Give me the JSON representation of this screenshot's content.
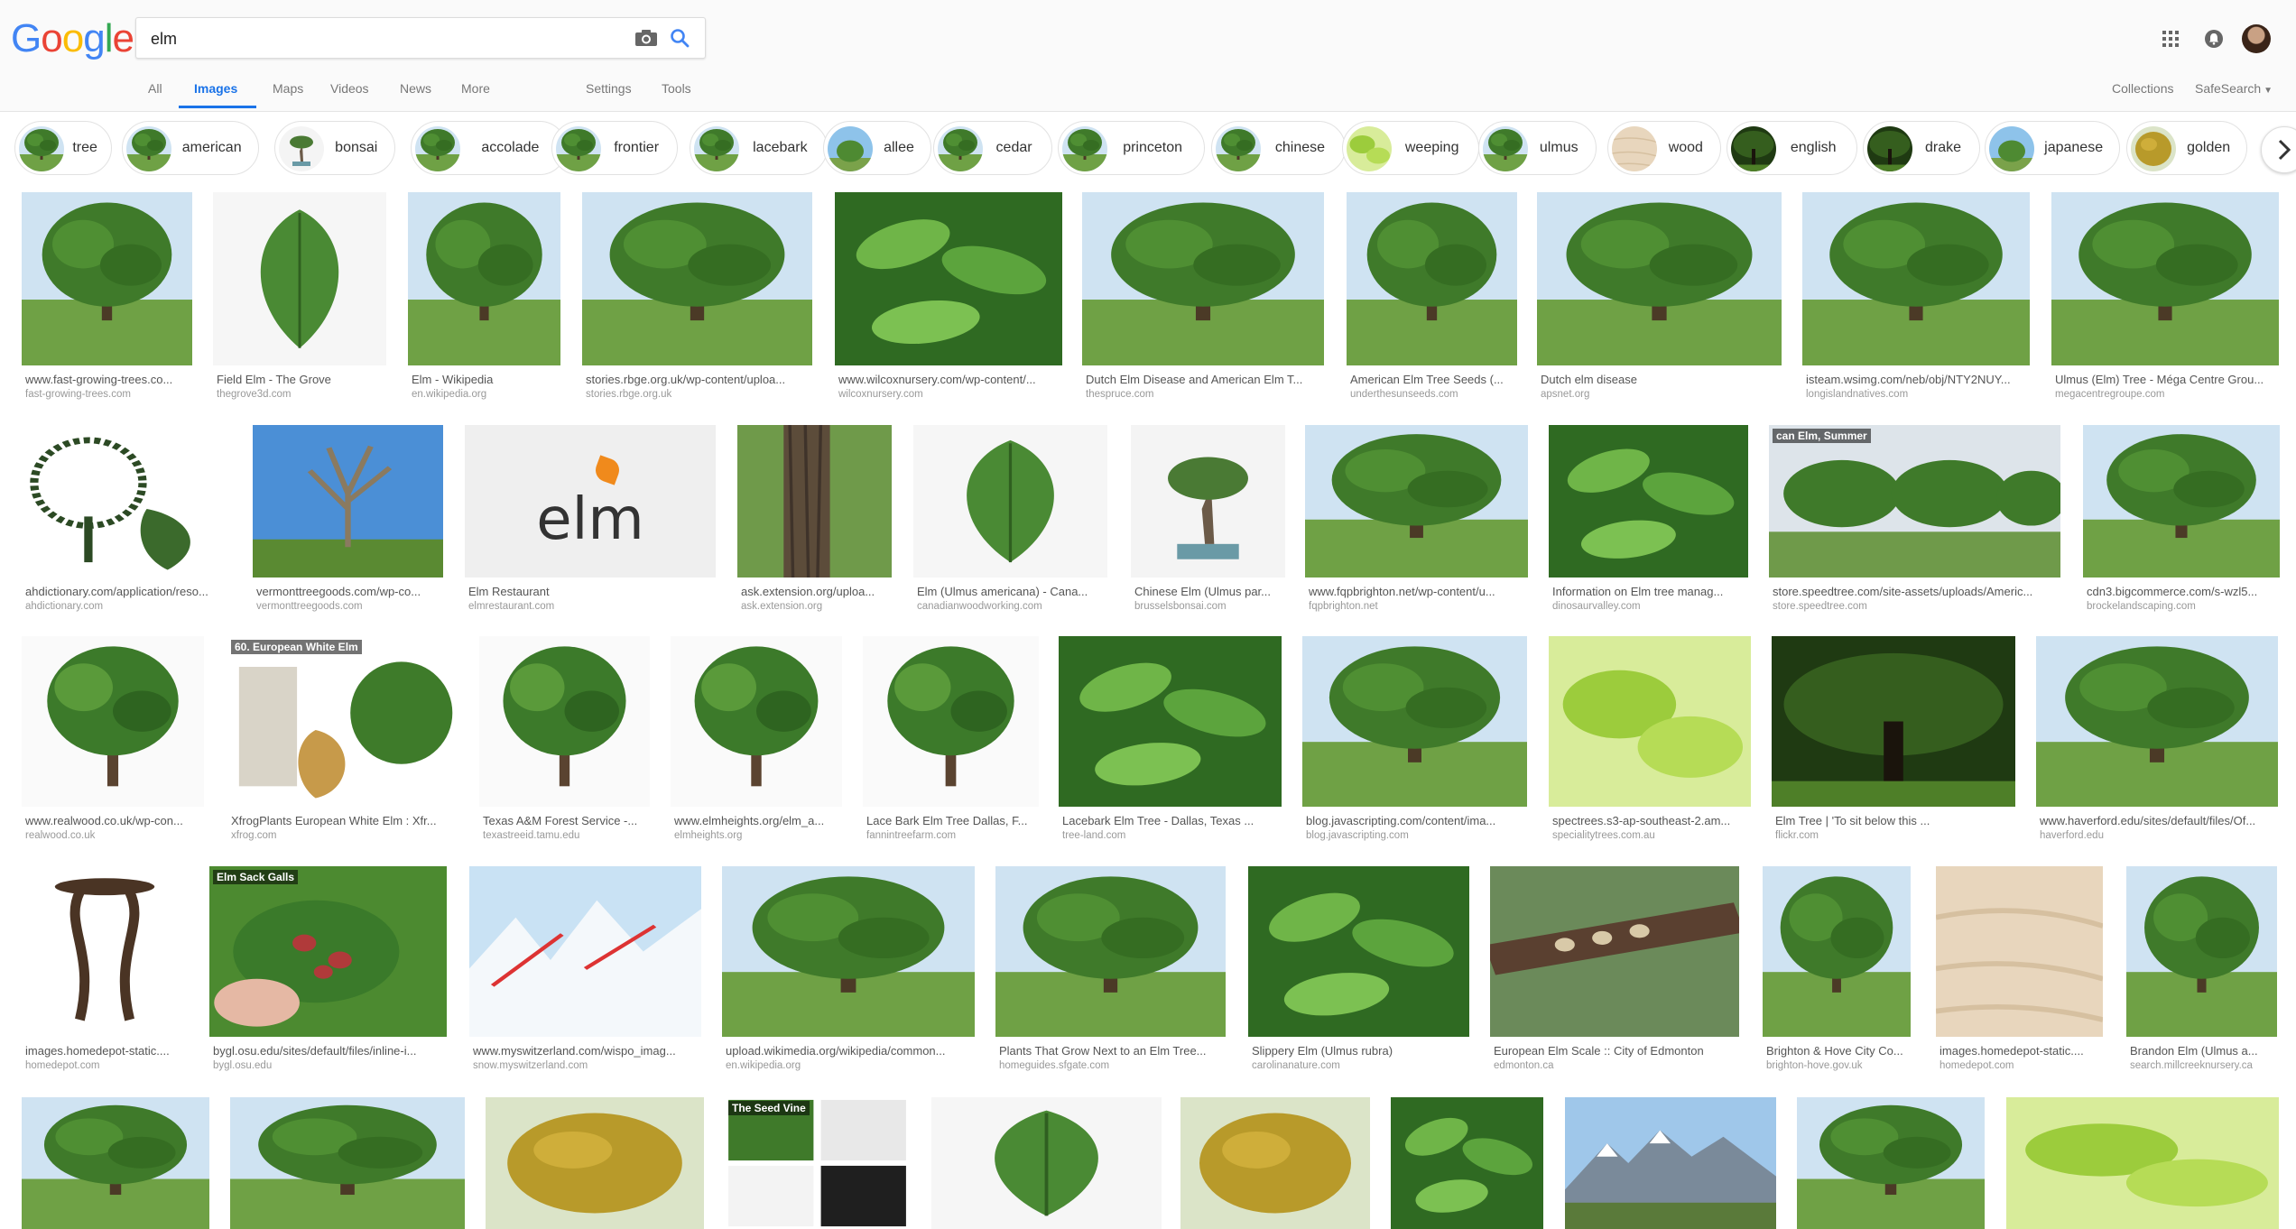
{
  "header": {
    "logo_letters": [
      {
        "ch": "G",
        "color": "#4285F4"
      },
      {
        "ch": "o",
        "color": "#EA4335"
      },
      {
        "ch": "o",
        "color": "#FBBC05"
      },
      {
        "ch": "g",
        "color": "#4285F4"
      },
      {
        "ch": "l",
        "color": "#34A853"
      },
      {
        "ch": "e",
        "color": "#EA4335"
      }
    ],
    "search_value": "elm"
  },
  "nav": {
    "tabs": [
      "All",
      "Images",
      "Maps",
      "Videos",
      "News",
      "More"
    ],
    "active_tab": "Images",
    "settings": "Settings",
    "tools": "Tools",
    "collections": "Collections",
    "safesearch": "SafeSearch"
  },
  "chips": [
    {
      "label": "tree",
      "kind": "tree"
    },
    {
      "label": "american",
      "kind": "tree"
    },
    {
      "label": "bonsai",
      "kind": "bonsai"
    },
    {
      "label": "accolade",
      "kind": "tree"
    },
    {
      "label": "frontier",
      "kind": "tree"
    },
    {
      "label": "lacebark",
      "kind": "tree"
    },
    {
      "label": "allee",
      "kind": "sky"
    },
    {
      "label": "cedar",
      "kind": "tree"
    },
    {
      "label": "princeton",
      "kind": "tree"
    },
    {
      "label": "chinese",
      "kind": "tree"
    },
    {
      "label": "weeping",
      "kind": "lightleaf"
    },
    {
      "label": "ulmus",
      "kind": "tree"
    },
    {
      "label": "wood",
      "kind": "wood"
    },
    {
      "label": "english",
      "kind": "dark"
    },
    {
      "label": "drake",
      "kind": "dark"
    },
    {
      "label": "japanese",
      "kind": "sky"
    },
    {
      "label": "golden",
      "kind": "golden"
    }
  ],
  "results": [
    {
      "title": "www.fast-growing-trees.co...",
      "site": "fast-growing-trees.com",
      "kind": "tree"
    },
    {
      "title": "Field Elm - The Grove",
      "site": "thegrove3d.com",
      "kind": "leafwhite"
    },
    {
      "title": "Elm - Wikipedia",
      "site": "en.wikipedia.org",
      "kind": "tree"
    },
    {
      "title": "stories.rbge.org.uk/wp-content/uploa...",
      "site": "stories.rbge.org.uk",
      "kind": "tree"
    },
    {
      "title": "www.wilcoxnursery.com/wp-content/...",
      "site": "wilcoxnursery.com",
      "kind": "leaves"
    },
    {
      "title": "Dutch Elm Disease and American Elm T...",
      "site": "thespruce.com",
      "kind": "tree"
    },
    {
      "title": "American Elm Tree Seeds (...",
      "site": "underthesunseeds.com",
      "kind": "tree"
    },
    {
      "title": "Dutch elm disease",
      "site": "apsnet.org",
      "kind": "tree"
    },
    {
      "title": "isteam.wsimg.com/neb/obj/NTY2NUY...",
      "site": "longislandnatives.com",
      "kind": "tree"
    },
    {
      "title": "Ulmus (Elm) Tree - Méga Centre Grou...",
      "site": "megacentregroupe.com",
      "kind": "tree"
    },
    {
      "title": "ahdictionary.com/application/reso...",
      "site": "ahdictionary.com",
      "kind": "drawing"
    },
    {
      "title": "vermonttreegoods.com/wp-co...",
      "site": "vermonttreegoods.com",
      "kind": "bare"
    },
    {
      "title": "Elm Restaurant",
      "site": "elmrestaurant.com",
      "kind": "logo",
      "logo_text": "elm"
    },
    {
      "title": "ask.extension.org/uploa...",
      "site": "ask.extension.org",
      "kind": "trunk"
    },
    {
      "title": "Elm (Ulmus americana) - Cana...",
      "site": "canadianwoodworking.com",
      "kind": "leafwhite"
    },
    {
      "title": "Chinese Elm (Ulmus par...",
      "site": "brusselsbonsai.com",
      "kind": "bonsai"
    },
    {
      "title": "www.fqpbrighton.net/wp-content/u...",
      "site": "fqpbrighton.net",
      "kind": "tree"
    },
    {
      "title": "Information on Elm tree manag...",
      "site": "dinosaurvalley.com",
      "kind": "leaves"
    },
    {
      "title": "store.speedtree.com/site-assets/uploads/Americ...",
      "site": "store.speedtree.com",
      "kind": "speedtree",
      "overlay_text": "can Elm, Summer"
    },
    {
      "title": "cdn3.bigcommerce.com/s-wzl5...",
      "site": "brockelandscaping.com",
      "kind": "tree"
    },
    {
      "title": "www.realwood.co.uk/wp-con...",
      "site": "realwood.co.uk",
      "kind": "treewhite"
    },
    {
      "title": "XfrogPlants European White Elm : Xfr...",
      "site": "xfrog.com",
      "kind": "xfrog",
      "overlay_text": "60. European White Elm"
    },
    {
      "title": "Texas A&M Forest Service -...",
      "site": "texastreeid.tamu.edu",
      "kind": "treewhite"
    },
    {
      "title": "www.elmheights.org/elm_a...",
      "site": "elmheights.org",
      "kind": "treewhite"
    },
    {
      "title": "Lace Bark Elm Tree Dallas, F...",
      "site": "fannintreefarm.com",
      "kind": "treewhite"
    },
    {
      "title": "Lacebark Elm Tree - Dallas, Texas ...",
      "site": "tree-land.com",
      "kind": "leaves"
    },
    {
      "title": "blog.javascripting.com/content/ima...",
      "site": "blog.javascripting.com",
      "kind": "tree"
    },
    {
      "title": "spectrees.s3-ap-southeast-2.am...",
      "site": "specialitytrees.com.au",
      "kind": "lightleaf"
    },
    {
      "title": "Elm Tree | 'To sit below this ...",
      "site": "flickr.com",
      "kind": "dark"
    },
    {
      "title": "www.haverford.edu/sites/default/files/Of...",
      "site": "haverford.edu",
      "kind": "tree"
    },
    {
      "title": "images.homedepot-static....",
      "site": "homedepot.com",
      "kind": "table"
    },
    {
      "title": "bygl.osu.edu/sites/default/files/inline-i...",
      "site": "bygl.osu.edu",
      "kind": "galls",
      "overlay_text": "Elm Sack Galls"
    },
    {
      "title": "www.myswitzerland.com/wispo_imag...",
      "site": "snow.myswitzerland.com",
      "kind": "map"
    },
    {
      "title": "upload.wikimedia.org/wikipedia/common...",
      "site": "en.wikipedia.org",
      "kind": "tree"
    },
    {
      "title": "Plants That Grow Next to an Elm Tree...",
      "site": "homeguides.sfgate.com",
      "kind": "tree"
    },
    {
      "title": "Slippery Elm (Ulmus rubra)",
      "site": "carolinanature.com",
      "kind": "leaves"
    },
    {
      "title": "European Elm Scale :: City of Edmonton",
      "site": "edmonton.ca",
      "kind": "scale"
    },
    {
      "title": "Brighton & Hove City Co...",
      "site": "brighton-hove.gov.uk",
      "kind": "tree"
    },
    {
      "title": "images.homedepot-static....",
      "site": "homedepot.com",
      "kind": "wood"
    },
    {
      "title": "Brandon Elm (Ulmus a...",
      "site": "search.millcreeknursery.ca",
      "kind": "tree"
    },
    {
      "title": "",
      "site": "",
      "kind": "tree"
    },
    {
      "title": "",
      "site": "",
      "kind": "tree"
    },
    {
      "title": "",
      "site": "",
      "kind": "golden"
    },
    {
      "title": "",
      "site": "",
      "kind": "seedvine",
      "overlay_text": "The Seed Vine"
    },
    {
      "title": "",
      "site": "",
      "kind": "leafwhite"
    },
    {
      "title": "",
      "site": "",
      "kind": "golden"
    },
    {
      "title": "",
      "site": "",
      "kind": "leaves"
    },
    {
      "title": "",
      "site": "",
      "kind": "mountain"
    },
    {
      "title": "",
      "site": "",
      "kind": "tree"
    },
    {
      "title": "",
      "site": "",
      "kind": "lightleaf"
    }
  ]
}
